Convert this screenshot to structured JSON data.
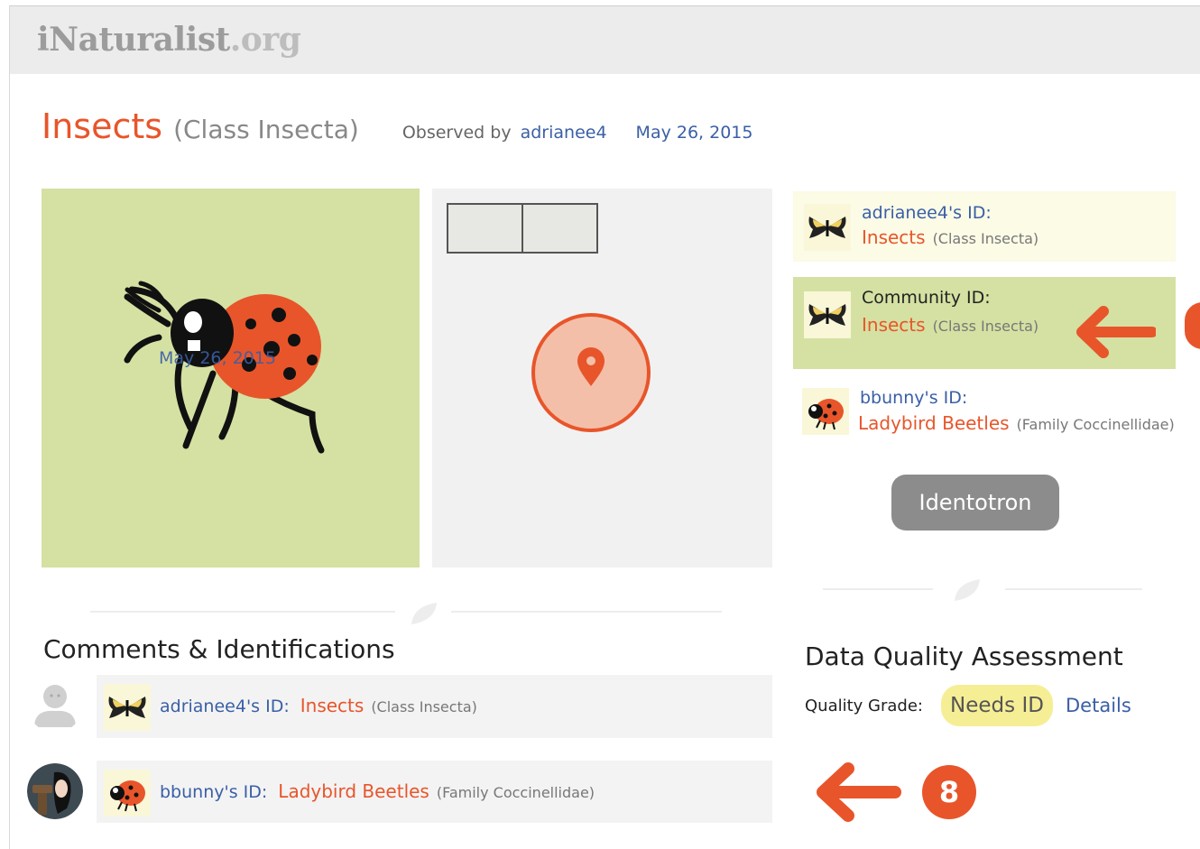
{
  "header": {
    "logo_main": "iNaturalist",
    "logo_suffix": ".org"
  },
  "observation": {
    "taxon_name": "Insects",
    "taxon_rank": "(Class Insecta)",
    "observed_by_label": "Observed by",
    "observer": "adrianee4",
    "date": "May 26, 2015",
    "photo_date_overlay": "May 26, 2015"
  },
  "identifications_panel": [
    {
      "who": "adrianee4's ID:",
      "taxon": "Insects",
      "rank": "(Class Insecta)",
      "icon": "swallowtail-butterfly-icon"
    },
    {
      "who": "Community ID:",
      "taxon": "Insects",
      "rank": "(Class Insecta)",
      "icon": "swallowtail-butterfly-icon"
    },
    {
      "who": "bbunny's ID:",
      "taxon": "Ladybird Beetles",
      "rank": "(Family Coccinellidae)",
      "icon": "ladybug-icon"
    }
  ],
  "identotron_button": "Identotron",
  "comments": {
    "title": "Comments & Identifications",
    "rows": [
      {
        "who": "adrianee4's ID:",
        "taxon": "Insects",
        "rank": "(Class Insecta)"
      },
      {
        "who": "bbunny's ID:",
        "taxon": "Ladybird Beetles",
        "rank": "(Family Coccinellidae)"
      }
    ]
  },
  "data_quality": {
    "title": "Data Quality Assessment",
    "grade_label": "Quality Grade:",
    "grade": "Needs ID",
    "details_link": "Details"
  },
  "annotation": {
    "step_number": "8"
  },
  "colors": {
    "accent_orange": "#e8552a",
    "link_blue": "#3a5fa6",
    "community_green": "#d4e1a2",
    "needs_id_yellow": "#f6ee95"
  }
}
